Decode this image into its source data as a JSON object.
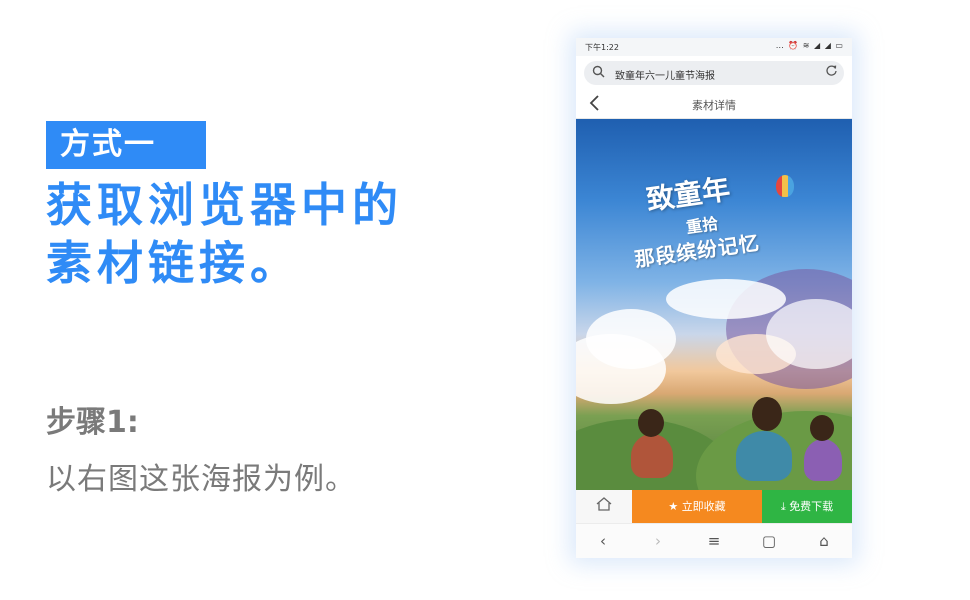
{
  "left": {
    "badge": "方式一",
    "headline_line1": "获取浏览器中的",
    "headline_line2": "素材链接。",
    "step_title": "步骤1:",
    "step_desc": "以右图这张海报为例。"
  },
  "phone": {
    "status_time": "下午1:22",
    "status_icons": "… ⏰ ≋ ◢ ◢ ▭",
    "url_text": "致童年六一儿童节海报",
    "page_title": "素材详情",
    "poster": {
      "title": "致童年",
      "line2": "重拾",
      "line3": "那段缤纷记忆"
    },
    "actions": {
      "favorite_label": "立即收藏",
      "download_label": "免费下载"
    }
  },
  "colors": {
    "accent_blue": "#2f8bf6",
    "favorite_orange": "#f5891f",
    "download_green": "#2fb544",
    "muted_text": "#7a7a7a"
  },
  "icons": {
    "search": "search-icon",
    "refresh": "refresh-icon",
    "back": "back-icon",
    "home": "home-icon",
    "star": "star-icon",
    "download": "download-icon"
  }
}
